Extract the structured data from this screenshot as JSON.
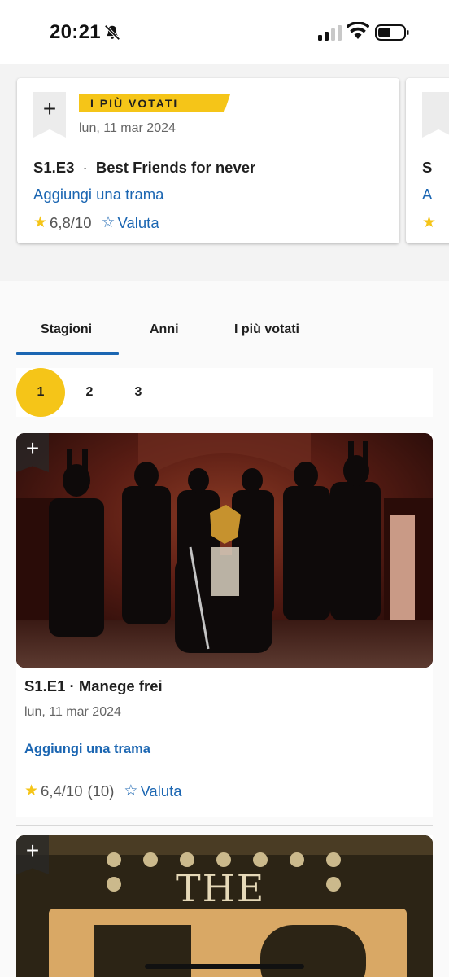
{
  "status_bar": {
    "time": "20:21"
  },
  "top_rated": {
    "card": {
      "tag": "I PIÙ VOTATI",
      "date": "lun, 11 mar 2024",
      "episode_code": "S1.E3",
      "episode_title": "Best Friends for never",
      "plot_link": "Aggiungi una trama",
      "rating": "6,8/10",
      "rate_label": "Valuta"
    },
    "peek_card": {
      "title_initial": "S",
      "plot_initial": "A"
    }
  },
  "episodes_section": {
    "tabs": [
      {
        "label": "Stagioni",
        "active": true
      },
      {
        "label": "Anni",
        "active": false
      },
      {
        "label": "I più votati",
        "active": false
      }
    ],
    "seasons": [
      "1",
      "2",
      "3"
    ],
    "selected_season": "1",
    "episodes": [
      {
        "title": "S1.E1 · Manege frei",
        "date": "lun, 11 mar 2024",
        "plot_link": "Aggiungi una trama",
        "rating": "6,4/10",
        "votes": "(10)",
        "rate_label": "Valuta"
      },
      {
        "poster_text": "THE"
      }
    ]
  },
  "colors": {
    "accent_yellow": "#f5c518",
    "link_blue": "#1b66b2"
  }
}
